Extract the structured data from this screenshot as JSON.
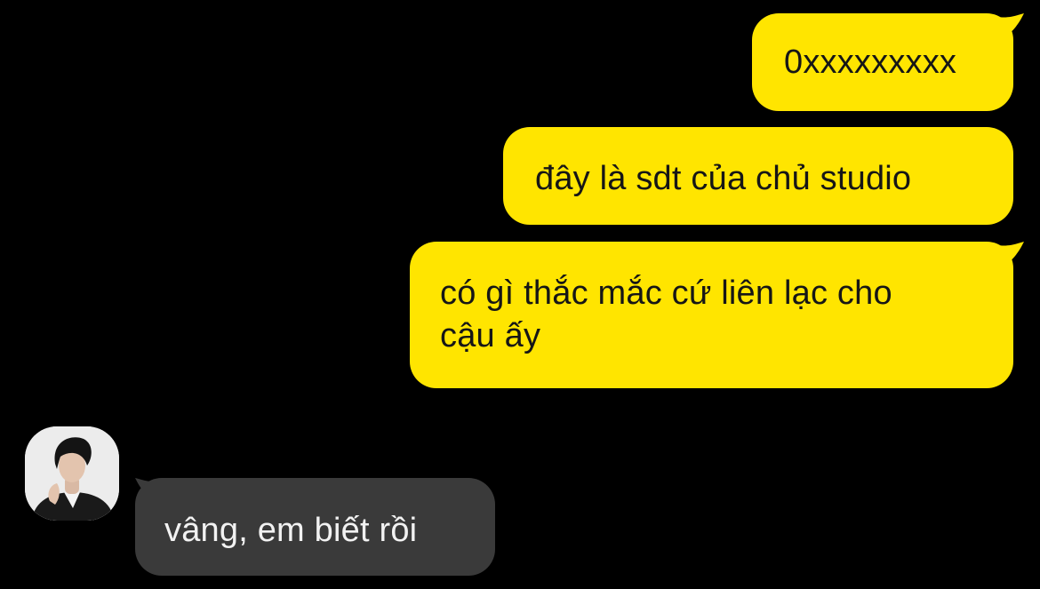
{
  "theme": {
    "background": "#000000",
    "outgoing_bubble": "#ffe500",
    "outgoing_text": "#161616",
    "incoming_bubble": "#3a3a3a",
    "incoming_text": "#f2f2f2"
  },
  "messages": [
    {
      "direction": "outgoing",
      "text": "0xxxxxxxxx"
    },
    {
      "direction": "outgoing",
      "text": "đây là sdt của chủ studio"
    },
    {
      "direction": "outgoing",
      "text": "có gì thắc mắc cứ liên lạc cho\ncậu ấy"
    },
    {
      "direction": "incoming",
      "text": "vâng, em biết rồi"
    }
  ],
  "contact": {
    "avatar_icon": "profile-photo-avatar"
  }
}
